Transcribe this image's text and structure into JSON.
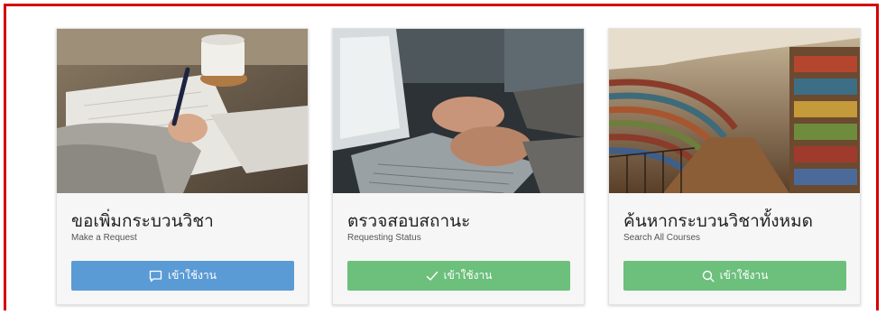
{
  "cards": [
    {
      "title": "ขอเพิ่มกระบวนวิชา",
      "subtitle": "Make a Request",
      "button_label": "เข้าใช้งาน",
      "button_icon": "chat-bubble-icon",
      "button_color": "#5b9bd5",
      "image": "writing-notebook-photo"
    },
    {
      "title": "ตรวจสอบสถานะ",
      "subtitle": "Requesting Status",
      "button_label": "เข้าใช้งาน",
      "button_icon": "checkmark-icon",
      "button_color": "#6cc07c",
      "image": "laptop-typing-photo"
    },
    {
      "title": "ค้นหากระบวนวิชาทั้งหมด",
      "subtitle": "Search All Courses",
      "button_label": "เข้าใช้งาน",
      "button_icon": "search-icon",
      "button_color": "#6cc07c",
      "image": "library-bookshelves-photo"
    }
  ],
  "colors": {
    "frame_border": "#d40000",
    "card_background": "#f6f6f6"
  }
}
